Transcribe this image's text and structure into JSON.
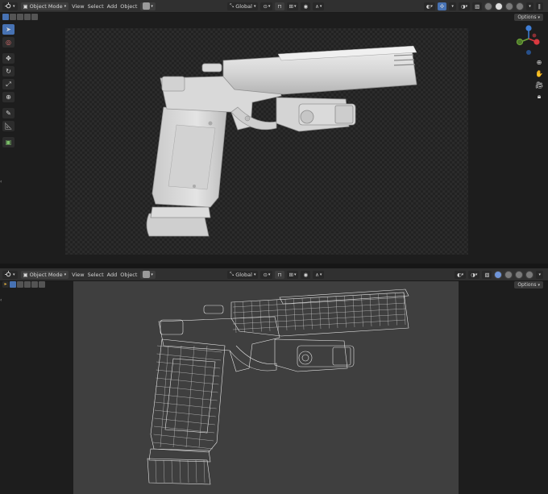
{
  "top_viewport": {
    "header": {
      "editor_icon": "3d-viewport-icon",
      "mode_label": "Object Mode",
      "menus": [
        "View",
        "Select",
        "Add",
        "Object"
      ],
      "orientation_label": "Global",
      "options_label": "Options"
    },
    "shading": "solid",
    "toolbar_tools": [
      "select-box",
      "cursor",
      "move",
      "rotate",
      "scale",
      "transform",
      "annotate",
      "measure",
      "add-cube"
    ],
    "gizmo_axes": [
      "X",
      "Y",
      "Z"
    ]
  },
  "bottom_viewport": {
    "header": {
      "editor_icon": "3d-viewport-icon",
      "mode_label": "Object Mode",
      "menus": [
        "View",
        "Select",
        "Add",
        "Object"
      ],
      "orientation_label": "Global",
      "options_label": "Options"
    },
    "shading": "wireframe"
  },
  "colors": {
    "accent": "#4772b3",
    "header_bg": "#303030",
    "viewport_bg": "#1d1d1d",
    "axis_x": "#d9393f",
    "axis_y": "#6ea53a",
    "axis_z": "#3f7ed6",
    "model_solid": "#d4d4d4",
    "model_wire": "#e6e6e6"
  },
  "model": {
    "object": "pistol"
  }
}
